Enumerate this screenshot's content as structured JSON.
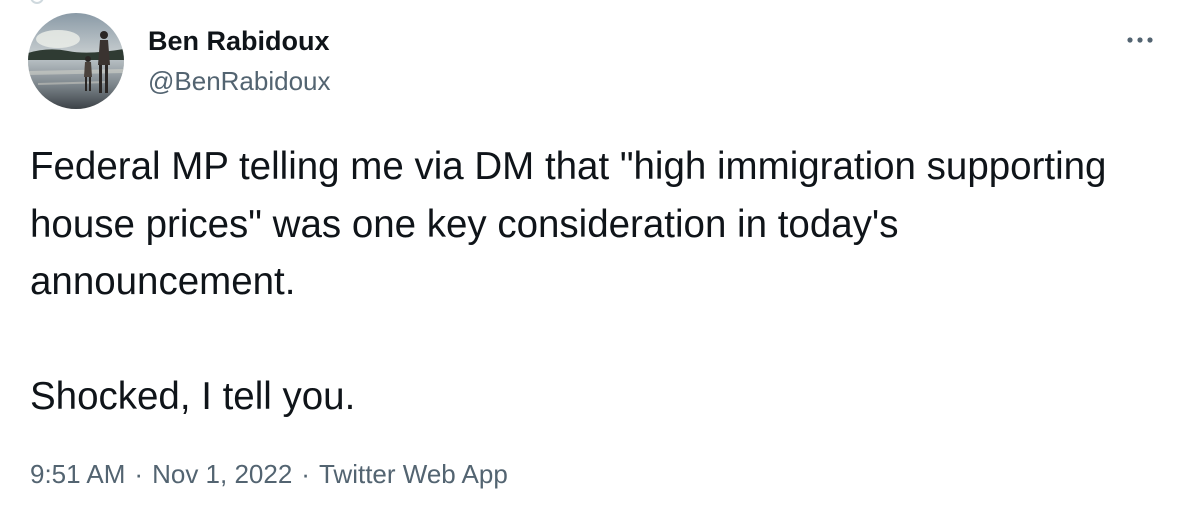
{
  "author": {
    "display_name": "Ben Rabidoux",
    "handle": "@BenRabidoux"
  },
  "tweet": {
    "paragraphs": [
      "Federal MP telling me via DM that \"high immigration supporting house prices\" was one key consideration in today's announcement.",
      "Shocked, I tell you."
    ]
  },
  "meta": {
    "time": "9:51 AM",
    "separator": "·",
    "date": "Nov 1, 2022",
    "source": "Twitter Web App"
  },
  "icons": {
    "more": "more-horizontal-icon"
  },
  "colors": {
    "text_primary": "#0f1419",
    "text_secondary": "#536471"
  }
}
